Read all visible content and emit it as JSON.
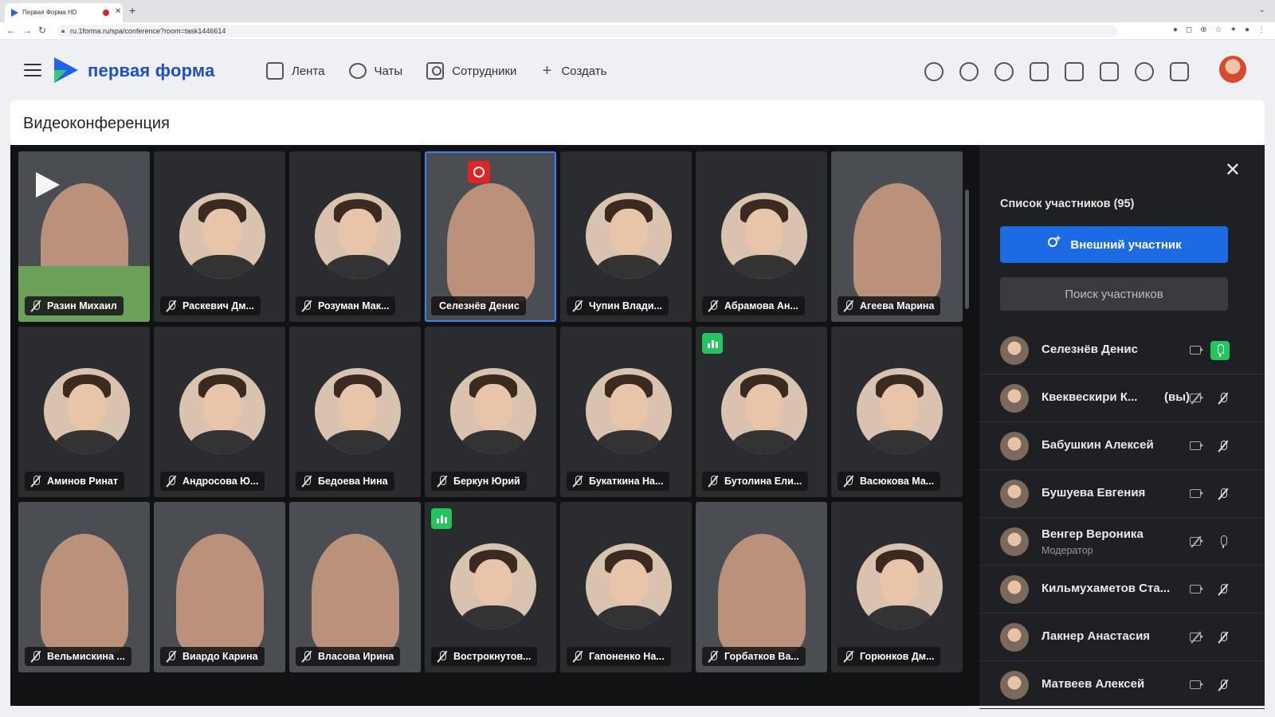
{
  "browser": {
    "tab_title": "Первая Форма HD",
    "url": "ru.1forma.ru/spa/conference?room=task1446614"
  },
  "header": {
    "logo_text": "первая форма",
    "nav": [
      {
        "label": "Лента",
        "icon": "feed-icon"
      },
      {
        "label": "Чаты",
        "icon": "chat-icon"
      },
      {
        "label": "Сотрудники",
        "icon": "employees-icon"
      },
      {
        "label": "Создать",
        "icon": "plus-icon"
      }
    ],
    "icons": [
      "search-icon",
      "alarm-icon",
      "star-icon",
      "mail-icon",
      "alert-icon",
      "docs-icon",
      "help-icon",
      "calendar-icon"
    ]
  },
  "page": {
    "title": "Видеоконференция"
  },
  "grid": {
    "tiles": [
      {
        "name": "Разин Михаил",
        "video": true
      },
      {
        "name": "Раскевич Дм..."
      },
      {
        "name": "Розуман Мак..."
      },
      {
        "name": "Селезнёв Денис",
        "video": true,
        "speaking": true,
        "recording": true
      },
      {
        "name": "Чупин Влади..."
      },
      {
        "name": "Абрамова Ан..."
      },
      {
        "name": "Агеева Марина",
        "video": true
      },
      {
        "name": "Аминов Ринат"
      },
      {
        "name": "Андросова Ю..."
      },
      {
        "name": "Бедоева Нина"
      },
      {
        "name": "Беркун Юрий"
      },
      {
        "name": "Букаткина На..."
      },
      {
        "name": "Бутолина Ели...",
        "talking": true
      },
      {
        "name": "Васюкова Ма..."
      },
      {
        "name": "Вельмискина ...",
        "video": true
      },
      {
        "name": "Виардо Карина",
        "video": true
      },
      {
        "name": "Власова Ирина",
        "video": true
      },
      {
        "name": "Вострокнутов...",
        "talking": true
      },
      {
        "name": "Гапоненко На..."
      },
      {
        "name": "Горбатков Ва...",
        "video": true
      },
      {
        "name": "Горюнков Дм..."
      }
    ]
  },
  "panel": {
    "title": "Список участников (95)",
    "external_button": "Внешний участник",
    "search_placeholder": "Поиск участников",
    "you_label": "(вы)",
    "participants": [
      {
        "name": "Селезнёв Денис",
        "cam": "on",
        "mic": "active"
      },
      {
        "name": "Квеквескири К...",
        "you": true,
        "cam": "off",
        "mic": "off"
      },
      {
        "name": "Бабушкин Алексей",
        "cam": "on",
        "mic": "off"
      },
      {
        "name": "Бушуева Евгения",
        "cam": "on",
        "mic": "off"
      },
      {
        "name": "Венгер Вероника",
        "role": "Модератор",
        "cam": "off",
        "mic": "on"
      },
      {
        "name": "Кильмухаметов Ста...",
        "cam": "on",
        "mic": "off"
      },
      {
        "name": "Лакнер Анастасия",
        "cam": "off",
        "mic": "off"
      },
      {
        "name": "Матвеев Алексей",
        "cam": "on",
        "mic": "off"
      }
    ]
  }
}
